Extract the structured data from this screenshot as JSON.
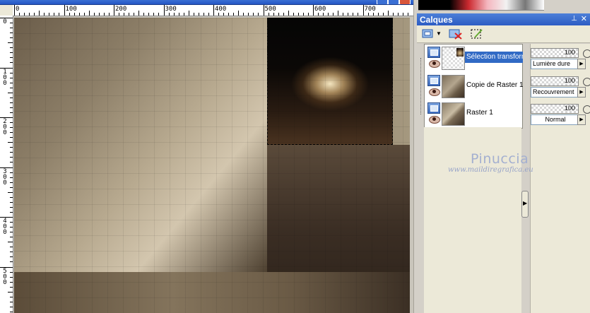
{
  "window": {
    "title": ""
  },
  "ruler": {
    "h_labels": [
      "0",
      "100",
      "200",
      "300",
      "400",
      "500",
      "600",
      "700"
    ],
    "v_labels": [
      "0",
      "1\n0\n0",
      "2\n0\n0",
      "3\n0\n0",
      "4\n0\n0",
      "5\n0\n0"
    ]
  },
  "layers_palette": {
    "title": "Calques",
    "layers": [
      {
        "name": "Sélection transformée",
        "opacity": "100",
        "blend_mode": "Lumière dure",
        "selected": true
      },
      {
        "name": "Copie de Raster 1",
        "opacity": "100",
        "blend_mode": "Recouvrement",
        "selected": false
      },
      {
        "name": "Raster 1",
        "opacity": "100",
        "blend_mode": "Normal",
        "selected": false
      }
    ]
  },
  "watermark": {
    "name": "Pinuccia",
    "url": "www.maildiregrafica.eu"
  },
  "colors": {
    "selection_highlight": "#316ac5",
    "titlebar": "#2c5cc3"
  }
}
